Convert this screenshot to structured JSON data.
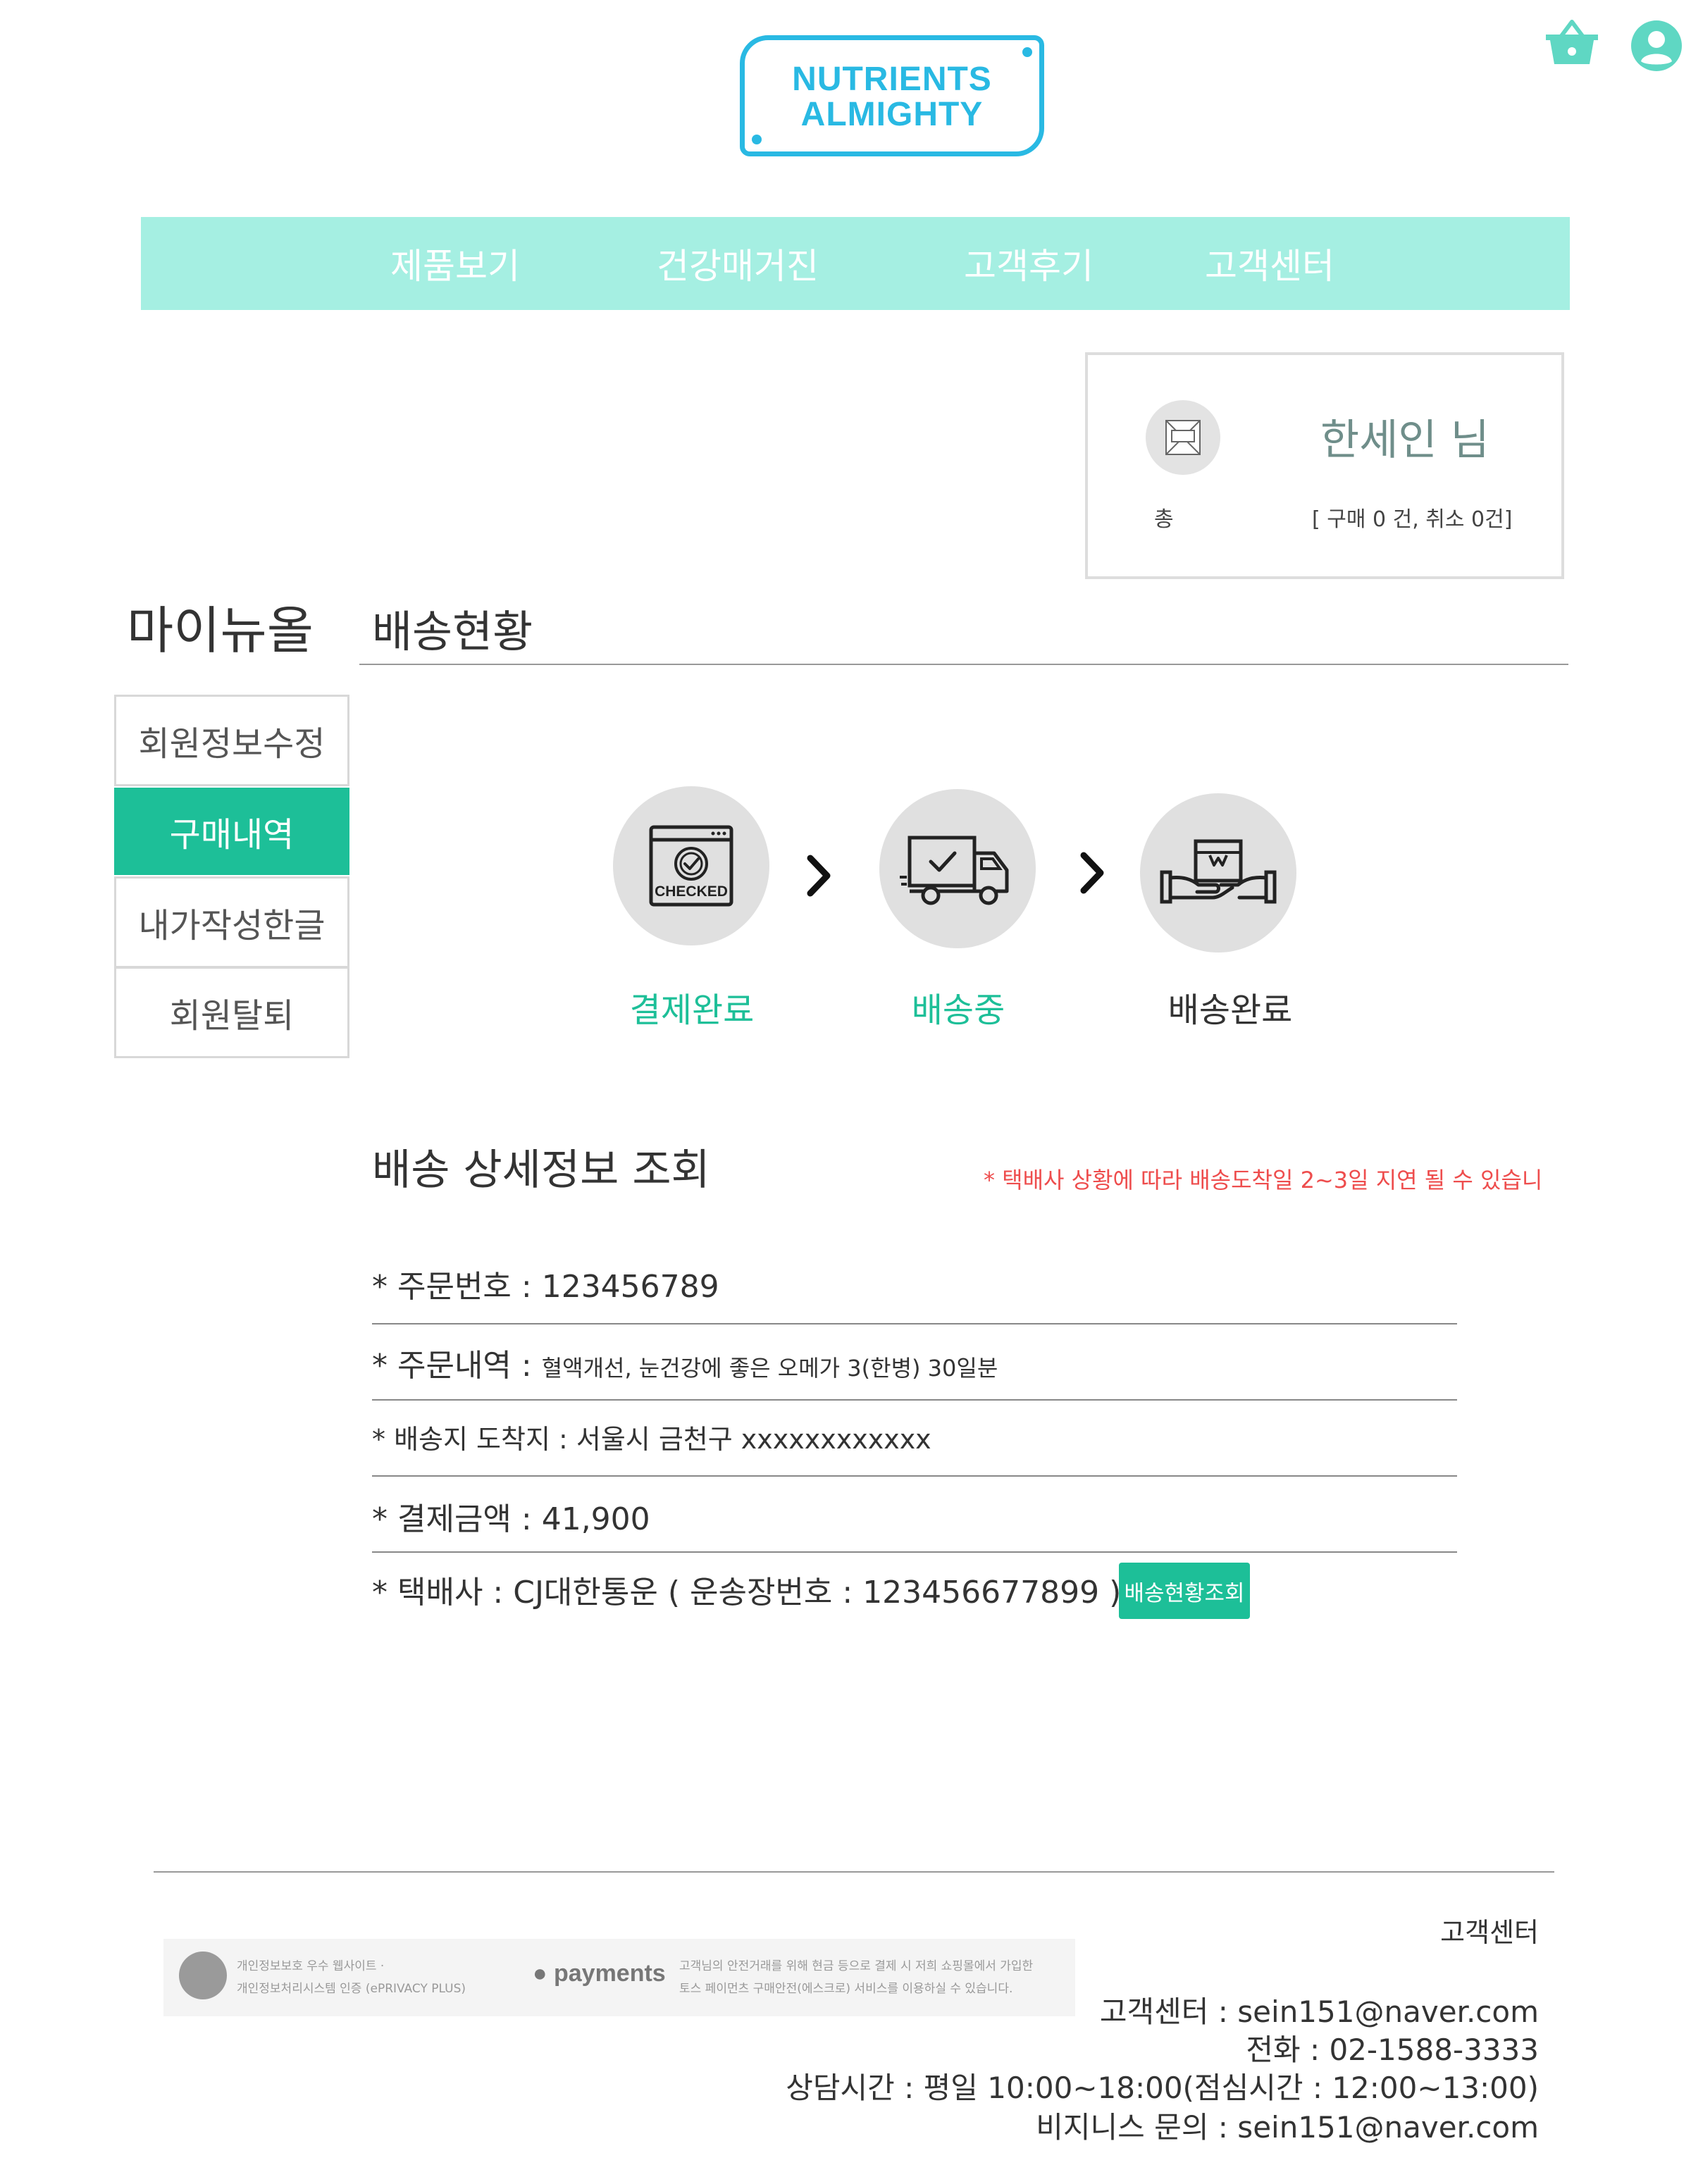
{
  "header": {
    "logo_line1": "NUTRIENTS",
    "logo_line2": "ALMIGHTY",
    "cart_icon": "basket-icon",
    "profile_icon": "user-circle-icon"
  },
  "nav": {
    "items": [
      "제품보기",
      "건강매거진",
      "고객후기",
      "고객센터"
    ]
  },
  "profile": {
    "avatar_label": "총",
    "name": "한세인 님",
    "stats": "[ 구매 0 건, 취소 0건]"
  },
  "page": {
    "mypage_title": "마이뉴올",
    "section_title": "배송현황"
  },
  "sidebar": {
    "items": [
      {
        "label": "회원정보수정",
        "active": false
      },
      {
        "label": "구매내역",
        "active": true
      },
      {
        "label": "내가작성한글",
        "active": false
      },
      {
        "label": "회원탈퇴",
        "active": false
      }
    ]
  },
  "steps": [
    {
      "label": "결제완료",
      "icon": "checked-payment-icon",
      "done": true,
      "icon_text": "CHECKED"
    },
    {
      "label": "배송중",
      "icon": "delivery-truck-icon",
      "done": true
    },
    {
      "label": "배송완료",
      "icon": "package-delivered-icon",
      "done": false
    }
  ],
  "detail": {
    "title": "배송 상세정보 조회",
    "notice": "* 택배사 상황에 따라 배송도착일 2~3일 지연 될 수 있습니",
    "order_no_label": "* 주문번호  : ",
    "order_no": "123456789",
    "order_items_label": "* 주문내역 : ",
    "order_items": "혈액개선, 눈건강에 좋은 오메가 3(한병) 30일분",
    "address_label": "* 배송지 도착지  : ",
    "address": "서울시 금천구 xxxxxxxxxxxx",
    "amount_label": "* 결제금액 : ",
    "amount": "41,900",
    "courier_label": "* 택배사 : ",
    "courier": "CJ대한통운 ( 운송장번호 : 123456677899 )",
    "track_button": "배송현황조회"
  },
  "footer": {
    "cert_line1": "개인정보보호 우수 웹사이트 ·",
    "cert_line2": "개인정보처리시스템 인증 (ePRIVACY PLUS)",
    "pay_logo": "payments",
    "pay_line1": "고객님의 안전거래를 위해 현금 등으로 결제 시 저희 쇼핑몰에서 가입한",
    "pay_line2": "토스 페이먼츠 구매안전(에스크로) 서비스를 이용하실 수 있습니다.",
    "cs_heading": "고객센터",
    "cs_email": "고객센터 : sein151@naver.com",
    "phone": "전화 : 02-1588-3333",
    "hours": "상담시간 : 평일 10:00~18:00(점심시간 : 12:00~13:00)",
    "business": "비지니스 문의 : sein151@naver.com"
  },
  "colors": {
    "accent": "#1dbf98",
    "nav_bg": "#a5efe2",
    "logo_blue": "#29b9e3",
    "icon_teal": "#5fd7c3",
    "notice_red": "#ee4d4d"
  }
}
